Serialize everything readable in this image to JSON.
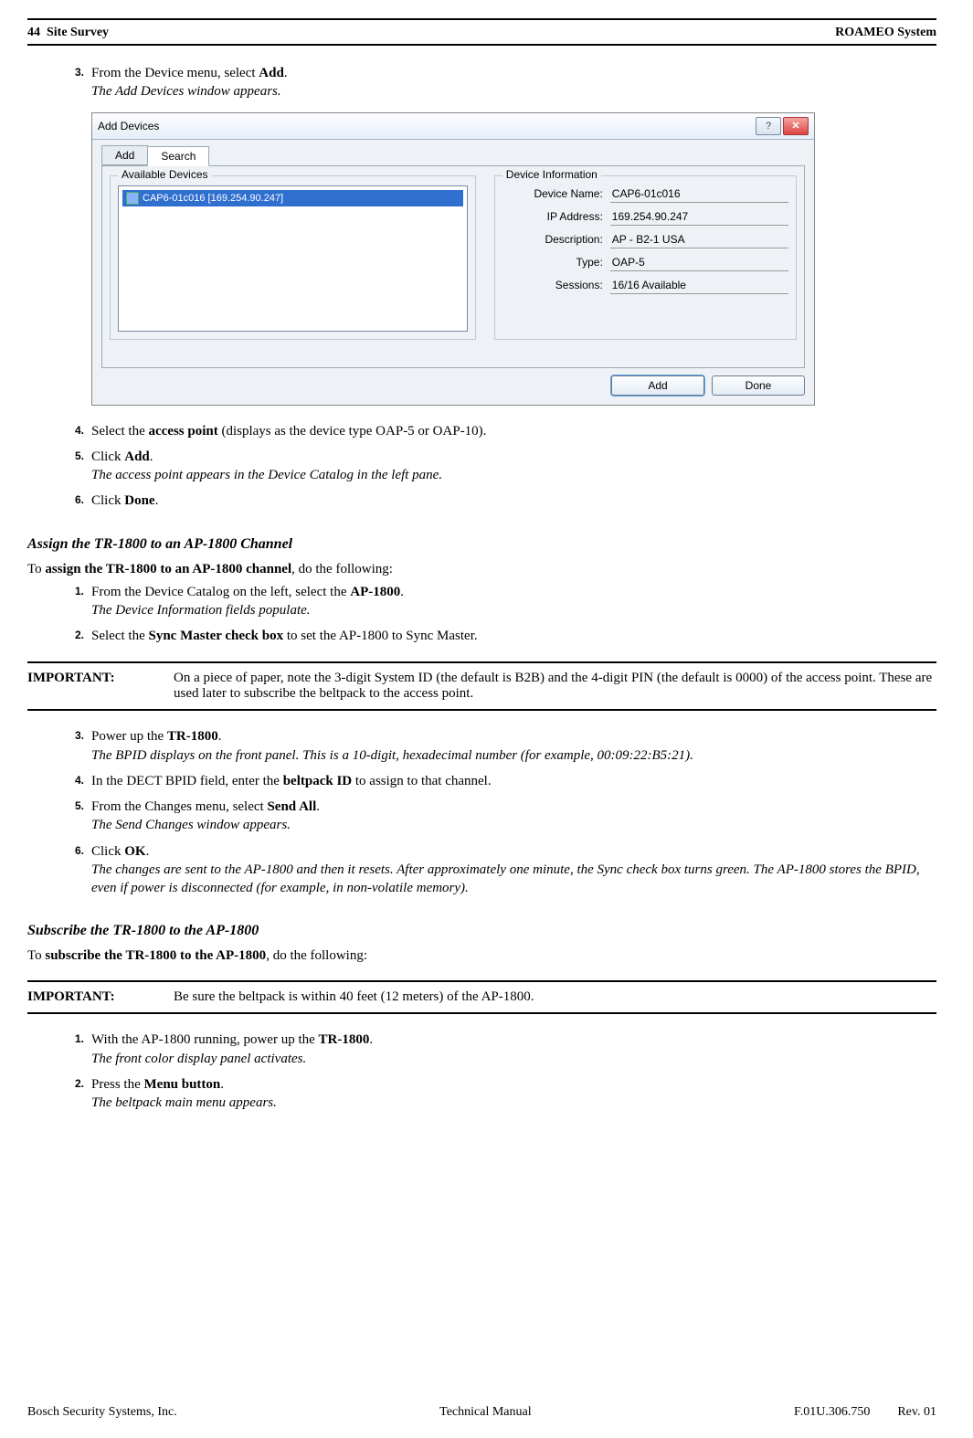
{
  "header": {
    "left_page": "44",
    "left_title": "Site Survey",
    "right": "ROAMEO System"
  },
  "stepsA": {
    "s3": {
      "num": "3.",
      "pre": "From the Device menu, select ",
      "bold": "Add",
      "post": ".",
      "result": "The Add Devices window appears."
    },
    "s4": {
      "num": "4.",
      "pre": "Select the ",
      "bold": "access point",
      "post": " (displays as the device type OAP-5 or OAP-10)."
    },
    "s5": {
      "num": "5.",
      "pre": "Click ",
      "bold": "Add",
      "post": ".",
      "result": "The access point appears in the Device Catalog in the left pane."
    },
    "s6": {
      "num": "6.",
      "pre": "Click ",
      "bold": "Done",
      "post": "."
    }
  },
  "dialog": {
    "title": "Add Devices",
    "tab_add": "Add",
    "tab_search": "Search",
    "legend_available": "Available Devices",
    "list_item": "CAP6-01c016 [169.254.90.247]",
    "legend_info": "Device Information",
    "rows": {
      "name_label": "Device Name:",
      "name_val": "CAP6-01c016",
      "ip_label": "IP Address:",
      "ip_val": "169.254.90.247",
      "desc_label": "Description:",
      "desc_val": "AP - B2-1 USA",
      "type_label": "Type:",
      "type_val": "OAP-5",
      "sess_label": "Sessions:",
      "sess_val": "16/16 Available"
    },
    "btn_add": "Add",
    "btn_done": "Done",
    "help_glyph": "?",
    "close_glyph": "✕"
  },
  "sectionB": {
    "title": "Assign the TR-1800 to an AP-1800 Channel",
    "intro_pre": "To ",
    "intro_bold": "assign the TR-1800 to an AP-1800 channel",
    "intro_post": ", do the following:",
    "s1": {
      "num": "1.",
      "pre": "From the Device Catalog on the left, select the ",
      "bold": "AP-1800",
      "post": ".",
      "result": "The Device Information fields populate."
    },
    "s2": {
      "num": "2.",
      "pre": "Select the ",
      "bold": "Sync Master check box",
      "post": " to set the AP-1800 to Sync Master."
    },
    "important1": {
      "label": "IMPORTANT:",
      "text": "On a piece of paper, note the 3-digit System ID (the default is B2B) and the 4-digit PIN (the default is 0000) of the access point. These are used later to subscribe the beltpack to the access point."
    },
    "s3": {
      "num": "3.",
      "pre": "Power up the ",
      "bold": "TR-1800",
      "post": ".",
      "result": "The BPID displays on the front panel. This is a 10-digit, hexadecimal number (for example, 00:09:22:B5:21)."
    },
    "s4": {
      "num": "4.",
      "pre": "In the DECT BPID field, enter the ",
      "bold": "beltpack ID",
      "post": " to assign to that channel."
    },
    "s5": {
      "num": "5.",
      "pre": "From the Changes menu, select ",
      "bold": "Send All",
      "post": ".",
      "result": "The Send Changes window appears."
    },
    "s6": {
      "num": "6.",
      "pre": "Click ",
      "bold": "OK",
      "post": ".",
      "result": "The changes are sent to the AP-1800 and then it resets. After approximately one minute, the Sync check box turns green. The AP-1800 stores the BPID, even if power is disconnected (for example, in non-volatile memory)."
    }
  },
  "sectionC": {
    "title": "Subscribe the TR-1800 to the AP-1800",
    "intro_pre": "To ",
    "intro_bold": "subscribe the TR-1800 to the AP-1800",
    "intro_post": ", do the following:",
    "important2": {
      "label": "IMPORTANT:",
      "text": "Be sure the beltpack is within 40 feet (12 meters) of the AP-1800."
    },
    "s1": {
      "num": "1.",
      "pre": "With the AP-1800 running, power up the ",
      "bold": "TR-1800",
      "post": ".",
      "result": "The front color display panel activates."
    },
    "s2": {
      "num": "2.",
      "pre": "Press the ",
      "bold": "Menu button",
      "post": ".",
      "result": "The beltpack main menu appears."
    }
  },
  "footer": {
    "left": "Bosch Security Systems, Inc.",
    "center": "Technical Manual",
    "doc": "F.01U.306.750",
    "rev": "Rev. 01"
  }
}
